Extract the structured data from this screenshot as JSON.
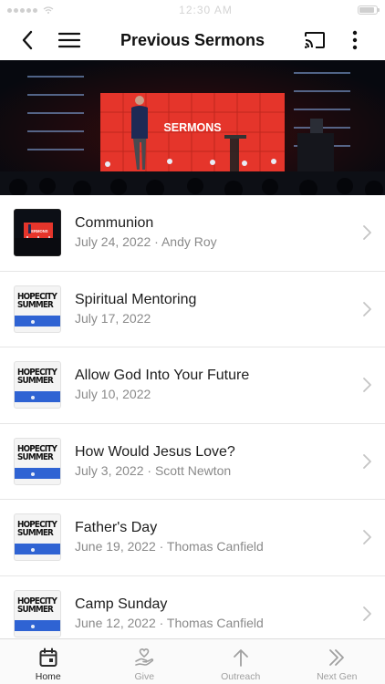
{
  "status_bar": {
    "time": "12:30 AM",
    "battery_level": 0.9
  },
  "header": {
    "title": "Previous Sermons",
    "back_icon": "chevron-left-icon",
    "menu_icon": "hamburger-menu-icon",
    "cast_icon": "cast-icon",
    "more_icon": "more-vertical-icon"
  },
  "hero": {
    "banner_text": "SERMONS"
  },
  "thumbnail_art": {
    "hopecity_line1": "HOPECITY",
    "hopecity_line2": "SUMMER",
    "communion_banner": "SERMONS"
  },
  "sermons": [
    {
      "title": "Communion",
      "date": "July 24, 2022",
      "speaker": "Andy Roy",
      "subtitle": "July 24, 2022 · Andy Roy",
      "thumbnail": "communion"
    },
    {
      "title": "Spiritual Mentoring",
      "date": "July 17, 2022",
      "speaker": "",
      "subtitle": "July 17, 2022",
      "thumbnail": "hopecity-summer"
    },
    {
      "title": "Allow God Into Your Future",
      "date": "July 10, 2022",
      "speaker": "",
      "subtitle": "July 10, 2022",
      "thumbnail": "hopecity-summer"
    },
    {
      "title": "How Would Jesus Love?",
      "date": "July 3, 2022",
      "speaker": "Scott Newton",
      "subtitle": "July 3, 2022 · Scott Newton",
      "thumbnail": "hopecity-summer"
    },
    {
      "title": "Father's Day",
      "date": "June 19, 2022",
      "speaker": "Thomas Canfield",
      "subtitle": "June 19, 2022 · Thomas Canfield",
      "thumbnail": "hopecity-summer"
    },
    {
      "title": "Camp Sunday",
      "date": "June 12, 2022",
      "speaker": "Thomas Canfield",
      "subtitle": "June 12, 2022 · Thomas Canfield",
      "thumbnail": "hopecity-summer"
    }
  ],
  "tab_bar": {
    "tabs": [
      {
        "label": "Home",
        "icon": "calendar-icon",
        "active": true
      },
      {
        "label": "Give",
        "icon": "giving-hand-heart-icon",
        "active": false
      },
      {
        "label": "Outreach",
        "icon": "arrow-up-icon",
        "active": false
      },
      {
        "label": "Next Gen",
        "icon": "double-chevron-right-icon",
        "active": false
      }
    ]
  },
  "colors": {
    "accent_blue": "#2f63d3",
    "stage_red": "#e5352b",
    "inactive_tab": "#a0a0a0",
    "active_tab": "#2b2b2b"
  }
}
